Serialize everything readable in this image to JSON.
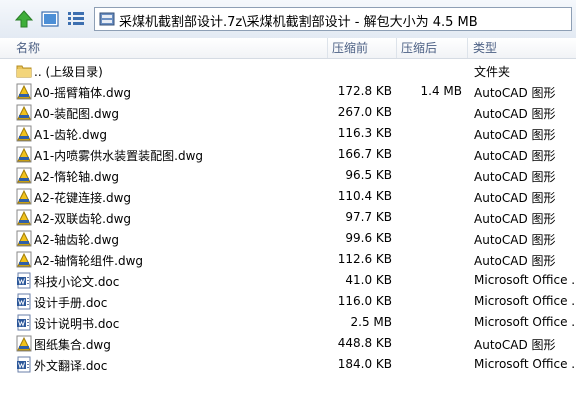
{
  "address": {
    "path": "采煤机截割部设计.7z\\采煤机截割部设计 - 解包大小为 4.5 MB"
  },
  "columns": {
    "name": "名称",
    "size": "压缩前",
    "packed": "压缩后",
    "type": "类型"
  },
  "rows": [
    {
      "name": ".. (上级目录)",
      "size": "",
      "packed": "",
      "type": "文件夹",
      "icon": "folder"
    },
    {
      "name": "A0-摇臂箱体.dwg",
      "size": "172.8 KB",
      "packed": "1.4 MB",
      "type": "AutoCAD 图形",
      "icon": "dwg"
    },
    {
      "name": "A0-装配图.dwg",
      "size": "267.0 KB",
      "packed": "",
      "type": "AutoCAD 图形",
      "icon": "dwg"
    },
    {
      "name": "A1-齿轮.dwg",
      "size": "116.3 KB",
      "packed": "",
      "type": "AutoCAD 图形",
      "icon": "dwg"
    },
    {
      "name": "A1-内喷雾供水装置装配图.dwg",
      "size": "166.7 KB",
      "packed": "",
      "type": "AutoCAD 图形",
      "icon": "dwg"
    },
    {
      "name": "A2-惰轮轴.dwg",
      "size": "96.5 KB",
      "packed": "",
      "type": "AutoCAD 图形",
      "icon": "dwg"
    },
    {
      "name": "A2-花键连接.dwg",
      "size": "110.4 KB",
      "packed": "",
      "type": "AutoCAD 图形",
      "icon": "dwg"
    },
    {
      "name": "A2-双联齿轮.dwg",
      "size": "97.7 KB",
      "packed": "",
      "type": "AutoCAD 图形",
      "icon": "dwg"
    },
    {
      "name": "A2-轴齿轮.dwg",
      "size": "99.6 KB",
      "packed": "",
      "type": "AutoCAD 图形",
      "icon": "dwg"
    },
    {
      "name": "A2-轴惰轮组件.dwg",
      "size": "112.6 KB",
      "packed": "",
      "type": "AutoCAD 图形",
      "icon": "dwg"
    },
    {
      "name": "科技小论文.doc",
      "size": "41.0 KB",
      "packed": "",
      "type": "Microsoft Office ...",
      "icon": "doc"
    },
    {
      "name": "设计手册.doc",
      "size": "116.0 KB",
      "packed": "",
      "type": "Microsoft Office ...",
      "icon": "doc"
    },
    {
      "name": "设计说明书.doc",
      "size": "2.5 MB",
      "packed": "",
      "type": "Microsoft Office ...",
      "icon": "doc"
    },
    {
      "name": "图纸集合.dwg",
      "size": "448.8 KB",
      "packed": "",
      "type": "AutoCAD 图形",
      "icon": "dwg"
    },
    {
      "name": "外文翻译.doc",
      "size": "184.0 KB",
      "packed": "",
      "type": "Microsoft Office ...",
      "icon": "doc"
    }
  ]
}
